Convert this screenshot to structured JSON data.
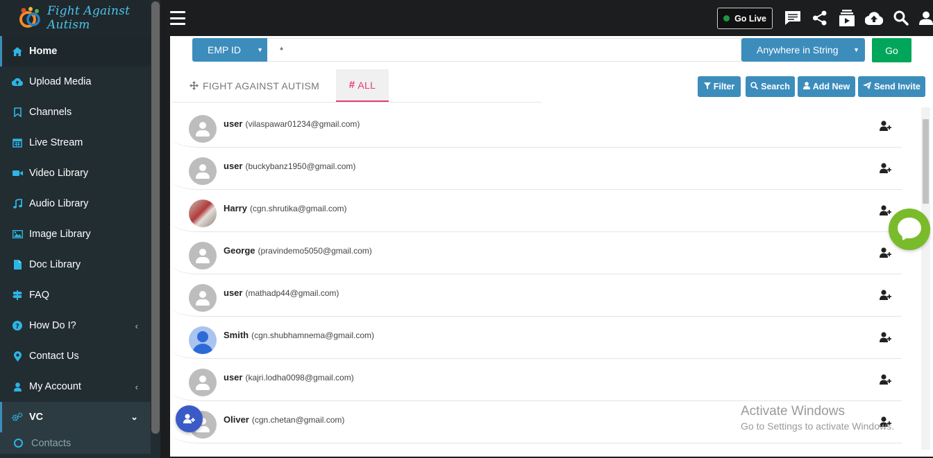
{
  "app": {
    "logo_text": "Fight Against Autism"
  },
  "sidebar": {
    "items": [
      {
        "label": "Home",
        "icon": "home-icon"
      },
      {
        "label": "Upload Media",
        "icon": "cloud-upload-icon"
      },
      {
        "label": "Channels",
        "icon": "bookmark-icon"
      },
      {
        "label": "Live Stream",
        "icon": "calendar-icon"
      },
      {
        "label": "Video Library",
        "icon": "video-camera-icon"
      },
      {
        "label": "Audio Library",
        "icon": "music-note-icon"
      },
      {
        "label": "Image Library",
        "icon": "image-icon"
      },
      {
        "label": "Doc Library",
        "icon": "document-icon"
      },
      {
        "label": "FAQ",
        "icon": "signpost-icon"
      },
      {
        "label": "How Do I?",
        "icon": "question-circle-icon"
      },
      {
        "label": "Contact Us",
        "icon": "map-pin-icon"
      },
      {
        "label": "My Account",
        "icon": "user-icon"
      },
      {
        "label": "VC",
        "icon": "cogs-icon"
      }
    ],
    "sub_items": [
      {
        "label": "Contacts"
      }
    ]
  },
  "topbar": {
    "go_live_label": "Go Live",
    "go_live_status_color": "#1a9a45"
  },
  "search": {
    "field_select": "EMP ID",
    "query": "*",
    "match_select": "Anywhere in String",
    "go_label": "Go"
  },
  "tabs": [
    {
      "label": "FIGHT AGAINST AUTISM",
      "icon": "move-arrows-icon"
    },
    {
      "label": "ALL",
      "icon": "hash-icon",
      "active": true
    }
  ],
  "actions": {
    "filter": "Filter",
    "search": "Search",
    "add_new": "Add New",
    "send_invite": "Send Invite"
  },
  "contacts": [
    {
      "name": "user",
      "email": "(vilaspawar01234@gmail.com)",
      "avatar": "default"
    },
    {
      "name": "user",
      "email": "(buckybanz1950@gmail.com)",
      "avatar": "default"
    },
    {
      "name": "Harry",
      "email": "(cgn.shrutika@gmail.com)",
      "avatar": "photo"
    },
    {
      "name": "George",
      "email": "(pravindemo5050@gmail.com)",
      "avatar": "default"
    },
    {
      "name": "user",
      "email": "(mathadp44@gmail.com)",
      "avatar": "default"
    },
    {
      "name": "Smith",
      "email": "(cgn.shubhamnema@gmail.com)",
      "avatar": "blue"
    },
    {
      "name": "user",
      "email": "(kajri.lodha0098@gmail.com)",
      "avatar": "default"
    },
    {
      "name": "Oliver",
      "email": "(cgn.chetan@gmail.com)",
      "avatar": "default"
    }
  ],
  "watermark": {
    "line1": "Activate Windows",
    "line2": "Go to Settings to activate Windows."
  },
  "colors": {
    "primary": "#3c8dbc",
    "success": "#00a65a",
    "accent_pink": "#e73a7a",
    "chat": "#79bb2b",
    "fab": "#3a5bc6"
  }
}
